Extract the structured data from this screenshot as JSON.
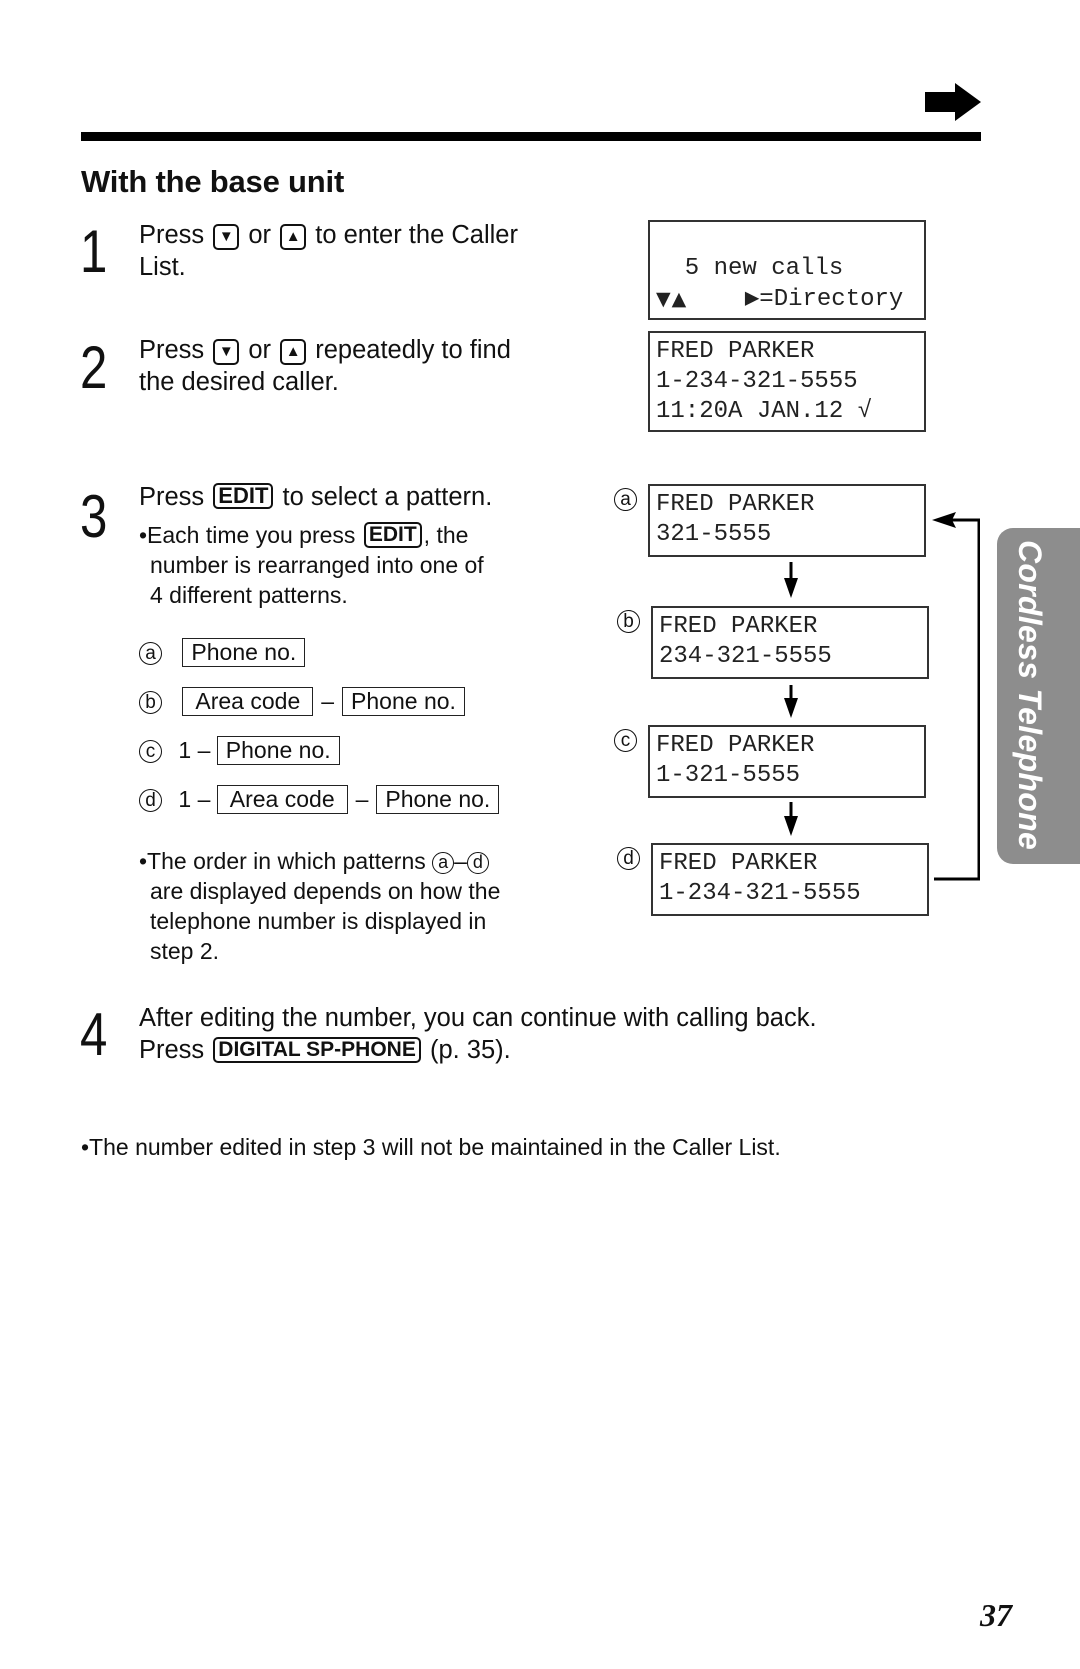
{
  "header": {
    "continue_icon": "right-arrow-icon"
  },
  "section_title": "With the base unit",
  "steps": [
    {
      "number": "1",
      "parts": [
        "Press",
        "or",
        "to enter the Caller",
        "List."
      ],
      "keys": [
        "▼",
        "▲"
      ]
    },
    {
      "number": "2",
      "parts": [
        "Press",
        "or",
        "repeatedly to find",
        "the desired caller."
      ],
      "keys": [
        "▼",
        "▲"
      ]
    },
    {
      "number": "3",
      "parts": [
        "Press",
        "to select a pattern."
      ],
      "key": "EDIT",
      "bullet": {
        "pre": "•Each time you press",
        "key": "EDIT",
        "post": ", the",
        "line2": "number is rearranged into one of",
        "line3": "4 different patterns."
      },
      "patterns": [
        {
          "label": "a",
          "prefix": "",
          "boxes": [
            "Phone no."
          ]
        },
        {
          "label": "b",
          "prefix": "",
          "boxes": [
            "Area code",
            "Phone no."
          ]
        },
        {
          "label": "c",
          "prefix": "1 –",
          "boxes": [
            "Phone no."
          ]
        },
        {
          "label": "d",
          "prefix": "1 –",
          "boxes": [
            "Area code",
            "Phone no."
          ]
        }
      ],
      "dash": "–",
      "note": {
        "pre": "•The order in which patterns",
        "from": "a",
        "sep": "–",
        "to": "d",
        "line2": "are displayed depends on how the",
        "line3": "telephone number is displayed in",
        "line4": "step 2."
      }
    },
    {
      "number": "4",
      "line1": "After editing the number, you can continue with calling back.",
      "pre": "Press",
      "key": "DIGITAL SP-PHONE",
      "post": "(p. 35)."
    }
  ],
  "displays": {
    "intro": {
      "line1": "  5 new calls",
      "line2_arrows": "▼▲",
      "line2_right": "▶=Directory"
    },
    "caller": {
      "line1": "FRED PARKER",
      "line2": "1-234-321-5555",
      "line3": "11:20A JAN.12 √"
    },
    "patterns": [
      {
        "label": "a",
        "line1": "FRED PARKER",
        "line2": "321-5555"
      },
      {
        "label": "b",
        "line1": "FRED PARKER",
        "line2": "234-321-5555"
      },
      {
        "label": "c",
        "line1": "FRED PARKER",
        "line2": "1-321-5555"
      },
      {
        "label": "d",
        "line1": "FRED PARKER",
        "line2": "1-234-321-5555"
      }
    ]
  },
  "footer_note": "•The number edited in step 3 will not be maintained in the Caller List.",
  "side_tab": "Cordless Telephone",
  "page_number": "37"
}
